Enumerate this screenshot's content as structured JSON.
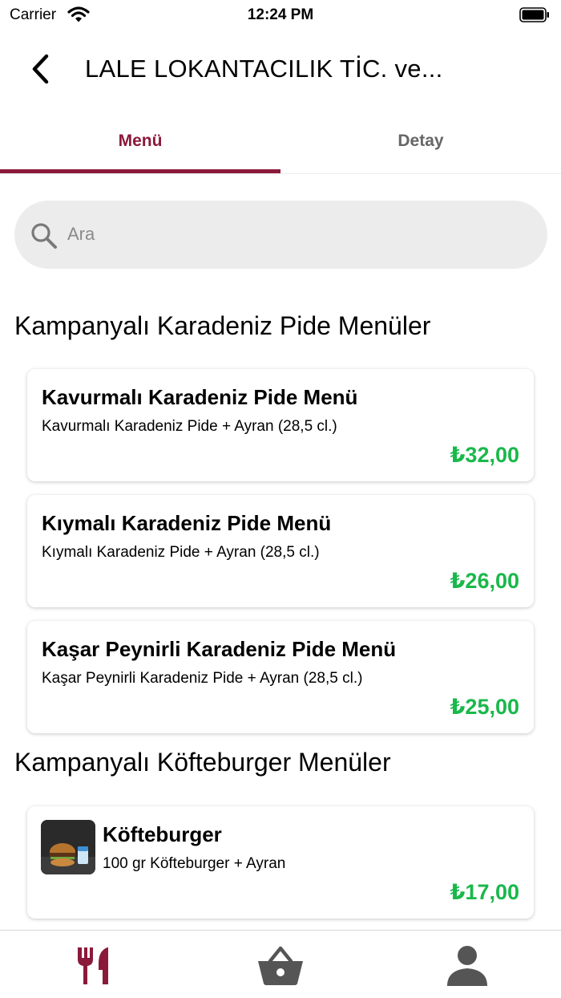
{
  "status_bar": {
    "carrier": "Carrier",
    "time": "12:24 PM"
  },
  "nav": {
    "title": "LALE LOKANTACILIK TİC. ve..."
  },
  "tabs": [
    {
      "label": "Menü",
      "active": true
    },
    {
      "label": "Detay",
      "active": false
    }
  ],
  "search": {
    "placeholder": "Ara"
  },
  "sections": [
    {
      "title": "Kampanyalı Karadeniz Pide Menüler",
      "items": [
        {
          "name": "Kavurmalı Karadeniz Pide Menü",
          "description": "Kavurmalı Karadeniz Pide + Ayran (28,5 cl.)",
          "price": "₺32,00"
        },
        {
          "name": "Kıymalı Karadeniz Pide Menü",
          "description": "Kıymalı Karadeniz Pide + Ayran (28,5 cl.)",
          "price": "₺26,00"
        },
        {
          "name": "Kaşar Peynirli Karadeniz Pide Menü",
          "description": "Kaşar Peynirli Karadeniz Pide + Ayran (28,5 cl.)",
          "price": "₺25,00"
        }
      ]
    },
    {
      "title": "Kampanyalı Köfteburger Menüler",
      "items": [
        {
          "name": "Köfteburger",
          "description": "100 gr Köfteburger + Ayran",
          "price": "₺17,00",
          "image": "burger-photo"
        }
      ]
    }
  ],
  "tab_bar": [
    {
      "icon": "restaurant-icon",
      "active": true
    },
    {
      "icon": "basket-icon",
      "active": false
    },
    {
      "icon": "profile-icon",
      "active": false
    }
  ],
  "colors": {
    "accent": "#8b1a3a",
    "price": "#19b84a",
    "inactive_icon": "#555555"
  }
}
